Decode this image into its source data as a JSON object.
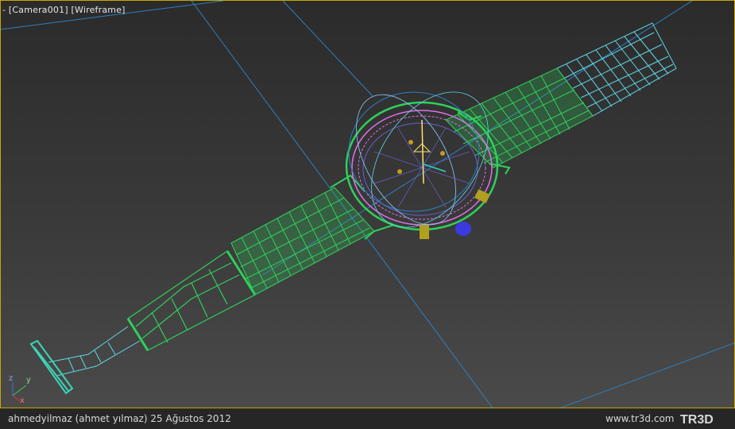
{
  "viewport": {
    "label_prefix": "-",
    "camera": "[Camera001]",
    "mode": "[Wireframe]",
    "border_color": "#c8a800"
  },
  "axis_gizmo": {
    "z": "z",
    "y": "y",
    "x": "x"
  },
  "footer": {
    "credit": "ahmedyilmaz (ahmet yılmaz)  25 Ağustos 2012",
    "site": "www.tr3d.com",
    "logo_text": "TR3D"
  },
  "colors": {
    "strap_green": "#2fd05a",
    "strap_cyan": "#5fd8e8",
    "bezel_magenta": "#e070e8",
    "dial_purple": "#6a5fd0",
    "guide_blue": "#2f7fc0"
  }
}
